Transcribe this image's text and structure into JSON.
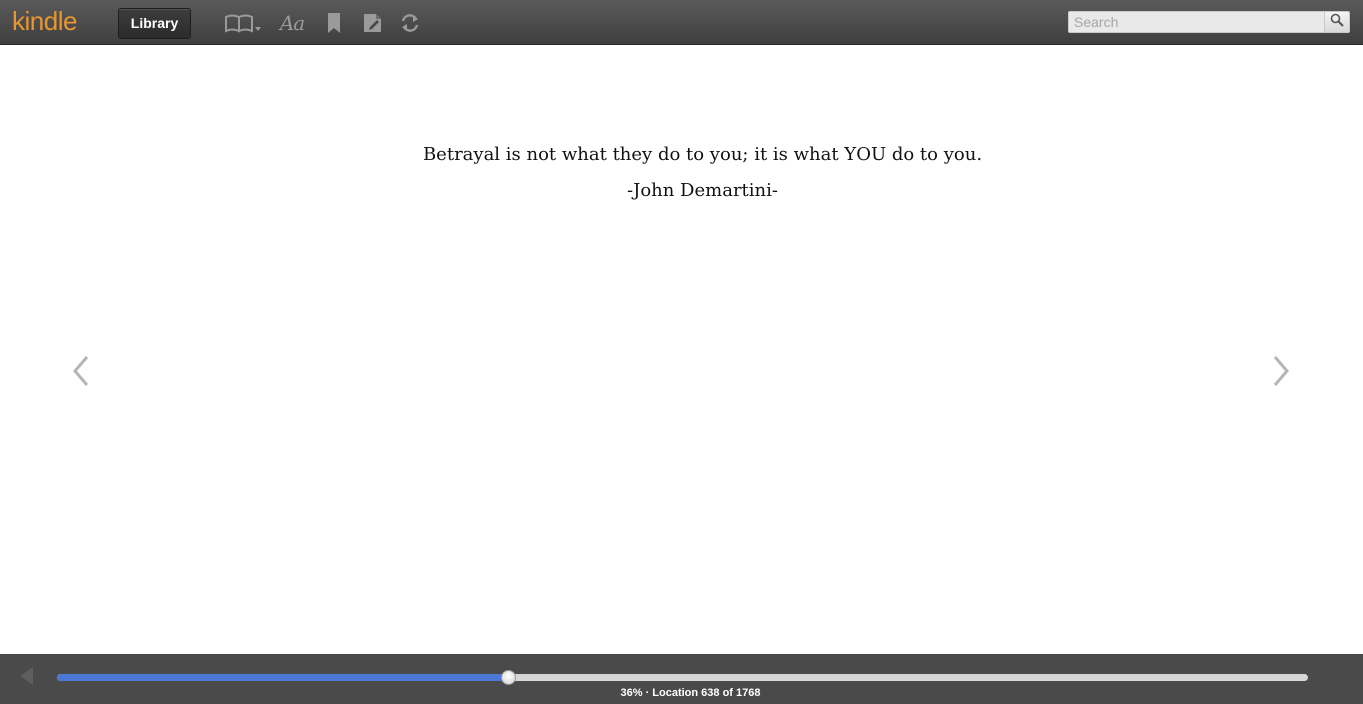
{
  "app": {
    "logo_text": "kindle",
    "accent_color": "#e8962f"
  },
  "toolbar": {
    "library_label": "Library",
    "icons": [
      "book-view-icon",
      "font-settings-icon",
      "bookmark-icon",
      "notes-icon",
      "sync-icon"
    ],
    "font_glyph": "Aa"
  },
  "search": {
    "placeholder": "Search",
    "value": ""
  },
  "page": {
    "quote": "Betrayal is not what they do to you; it is what YOU do to you.",
    "author": "-John Demartini-"
  },
  "progress": {
    "percent": 36,
    "location": 638,
    "total": 1768,
    "label": "36% · Location 638 of 1768",
    "fill_color": "#4a78d4"
  }
}
